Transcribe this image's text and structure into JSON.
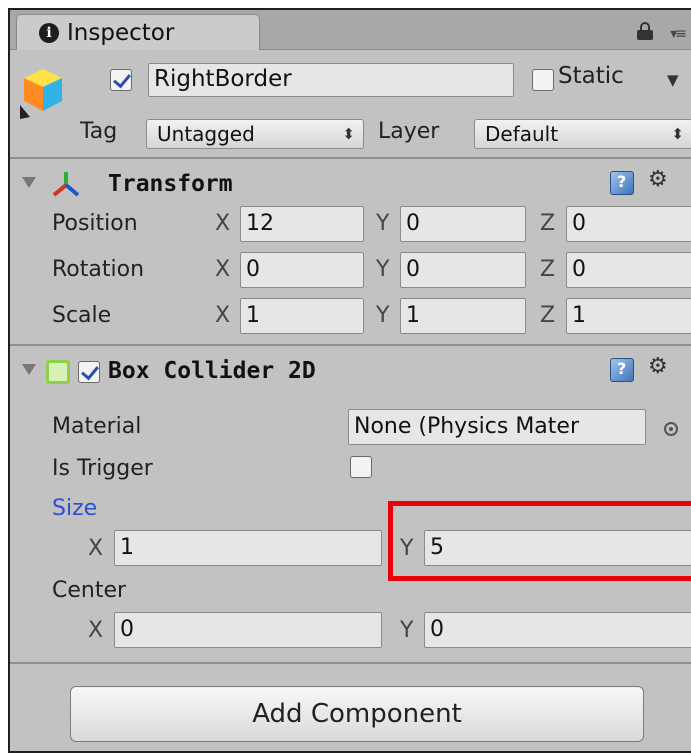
{
  "tab": {
    "title": "Inspector",
    "info_glyph": "i"
  },
  "object": {
    "active": true,
    "name": "RightBorder",
    "static_checked": false,
    "static_label": "Static",
    "tag_label": "Tag",
    "tag_value": "Untagged",
    "layer_label": "Layer",
    "layer_value": "Default"
  },
  "transform": {
    "title": "Transform",
    "rows": [
      {
        "label": "Position",
        "x": "12",
        "y": "0",
        "z": "0"
      },
      {
        "label": "Rotation",
        "x": "0",
        "y": "0",
        "z": "0"
      },
      {
        "label": "Scale",
        "x": "1",
        "y": "1",
        "z": "1"
      }
    ]
  },
  "box_collider": {
    "enabled": true,
    "title": "Box Collider 2D",
    "material_label": "Material",
    "material_value": "None (Physics Mater",
    "is_trigger_label": "Is Trigger",
    "is_trigger": false,
    "size_label": "Size",
    "size_x": "1",
    "size_y": "5",
    "center_label": "Center",
    "center_x": "0",
    "center_y": "0"
  },
  "axes": {
    "x": "X",
    "y": "Y",
    "z": "Z"
  },
  "add_component_label": "Add Component",
  "icons": {
    "lock": "lock-icon",
    "menu": "tab-menu-icon",
    "cube": "gameobject-cube-icon",
    "transform": "transform-axes-icon",
    "collider": "box-collider-icon",
    "help": "help-book-icon",
    "gear": "gear-icon"
  },
  "colors": {
    "panel": "#c2c2c2",
    "size_label": "#2c4fd6",
    "highlight": "#e8000a"
  }
}
